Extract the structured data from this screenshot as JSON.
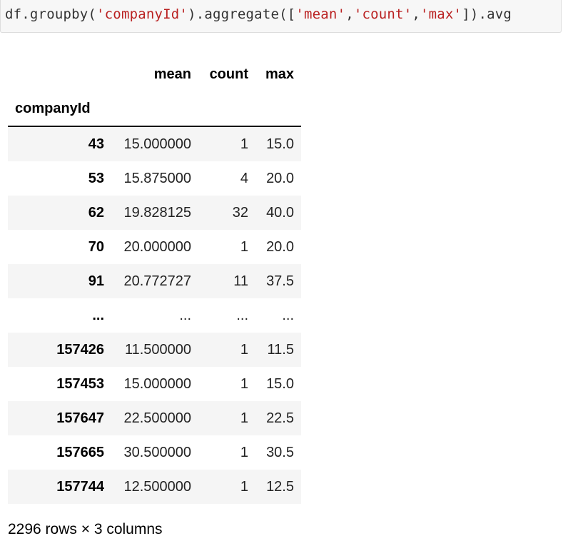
{
  "code": {
    "segments": [
      {
        "text": "df.groupby(",
        "type": "plain"
      },
      {
        "text": "'companyId'",
        "type": "str"
      },
      {
        "text": ").aggregate([",
        "type": "plain"
      },
      {
        "text": "'mean'",
        "type": "str"
      },
      {
        "text": ",",
        "type": "plain"
      },
      {
        "text": "'count'",
        "type": "str"
      },
      {
        "text": ",",
        "type": "plain"
      },
      {
        "text": "'max'",
        "type": "str"
      },
      {
        "text": "]).avg",
        "type": "plain"
      }
    ],
    "string_color": "#ba2121"
  },
  "table": {
    "index_name": "companyId",
    "columns": [
      "mean",
      "count",
      "max"
    ],
    "rows": [
      {
        "index": "43",
        "values": [
          "15.000000",
          "1",
          "15.0"
        ]
      },
      {
        "index": "53",
        "values": [
          "15.875000",
          "4",
          "20.0"
        ]
      },
      {
        "index": "62",
        "values": [
          "19.828125",
          "32",
          "40.0"
        ]
      },
      {
        "index": "70",
        "values": [
          "20.000000",
          "1",
          "20.0"
        ]
      },
      {
        "index": "91",
        "values": [
          "20.772727",
          "11",
          "37.5"
        ]
      },
      {
        "index": "...",
        "values": [
          "...",
          "...",
          "..."
        ]
      },
      {
        "index": "157426",
        "values": [
          "11.500000",
          "1",
          "11.5"
        ]
      },
      {
        "index": "157453",
        "values": [
          "15.000000",
          "1",
          "15.0"
        ]
      },
      {
        "index": "157647",
        "values": [
          "22.500000",
          "1",
          "22.5"
        ]
      },
      {
        "index": "157665",
        "values": [
          "30.500000",
          "1",
          "30.5"
        ]
      },
      {
        "index": "157744",
        "values": [
          "12.500000",
          "1",
          "12.5"
        ]
      }
    ]
  },
  "footer": {
    "shape_text": "2296 rows × 3 columns"
  }
}
